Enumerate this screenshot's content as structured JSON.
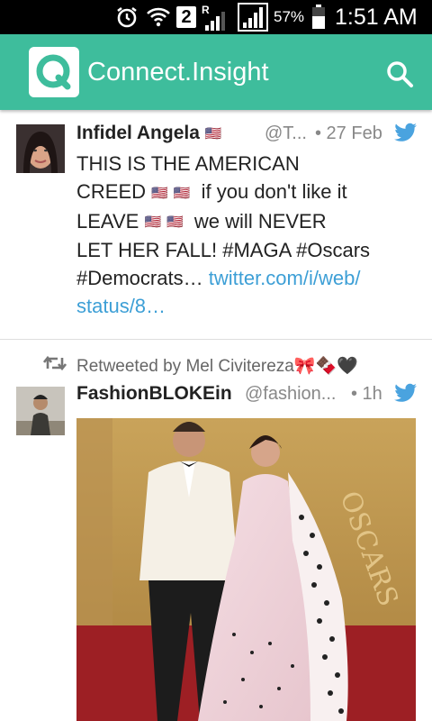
{
  "status_bar": {
    "battery": "57%",
    "time": "1:51 AM",
    "sim": "2",
    "roaming": "R"
  },
  "app": {
    "title": "Connect.Insight",
    "accent": "#3ebd9c"
  },
  "tweets": [
    {
      "name": "Infidel Angela",
      "name_emoji": "🇺🇸",
      "handle": "@T...",
      "time": "• 27 Feb",
      "text_line1": "THIS IS THE AMERICAN",
      "text_line2_a": "CREED",
      "text_line2_b": "if you don't like it",
      "text_line3_a": "LEAVE",
      "text_line3_b": "we will NEVER",
      "text_line4": "LET HER FALL! #MAGA #Oscars",
      "text_line5_a": "#Democrats…",
      "link_a": "twitter.com/i/web/",
      "link_b": "status/8…",
      "flags": "🇺🇸🇺🇸"
    },
    {
      "retweeted_by": "Retweeted by Mel Civitereza🎀🍫🖤",
      "name": "FashionBLOKEin",
      "handle": "@fashion...",
      "time": "• 1h"
    }
  ]
}
